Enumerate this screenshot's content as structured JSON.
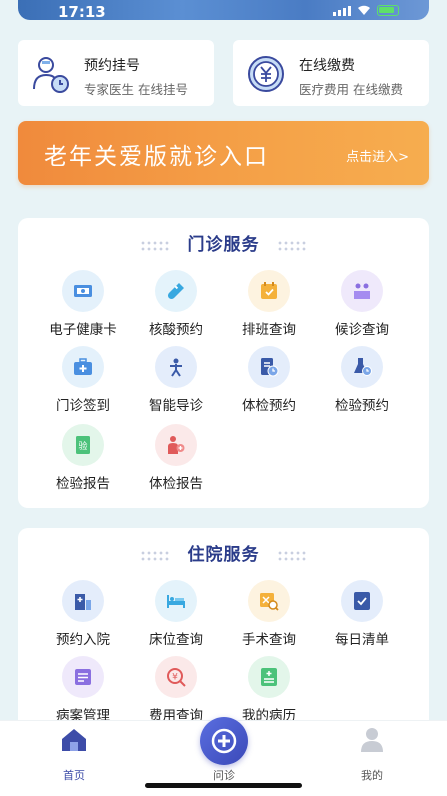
{
  "status": {
    "time": "17:13"
  },
  "quick": [
    {
      "title": "预约挂号",
      "sub": "专家医生 在线挂号",
      "icon": "doctor-appointment-icon"
    },
    {
      "title": "在线缴费",
      "sub": "医疗费用 在线缴费",
      "icon": "yuan-payment-icon"
    }
  ],
  "elder": {
    "title": "老年关爱版就诊入口",
    "link": "点击进入>"
  },
  "outpatient": {
    "title": "门诊服务",
    "items": [
      {
        "label": "电子健康卡",
        "icon": "health-card-icon"
      },
      {
        "label": "核酸预约",
        "icon": "test-tube-icon"
      },
      {
        "label": "排班查询",
        "icon": "calendar-icon"
      },
      {
        "label": "候诊查询",
        "icon": "waiting-room-icon"
      },
      {
        "label": "门诊签到",
        "icon": "medical-kit-icon"
      },
      {
        "label": "智能导诊",
        "icon": "guide-person-icon"
      },
      {
        "label": "体检预约",
        "icon": "checkup-clock-icon"
      },
      {
        "label": "检验预约",
        "icon": "flask-clock-icon"
      },
      {
        "label": "检验报告",
        "icon": "lab-report-icon"
      },
      {
        "label": "体检报告",
        "icon": "person-report-icon"
      }
    ]
  },
  "inpatient": {
    "title": "住院服务",
    "items": [
      {
        "label": "预约入院",
        "icon": "hospital-building-icon"
      },
      {
        "label": "床位查询",
        "icon": "bed-icon"
      },
      {
        "label": "手术查询",
        "icon": "surgery-search-icon"
      },
      {
        "label": "每日清单",
        "icon": "checklist-icon"
      },
      {
        "label": "病案管理",
        "icon": "case-file-icon"
      },
      {
        "label": "费用查询",
        "icon": "fee-search-icon"
      },
      {
        "label": "我的病历",
        "icon": "medical-record-icon"
      }
    ]
  },
  "tabs": [
    {
      "label": "首页",
      "icon": "home-icon"
    },
    {
      "label": "问诊",
      "icon": "plus-icon"
    },
    {
      "label": "我的",
      "icon": "user-icon"
    }
  ],
  "colors": {
    "accent": "#3d4ca8",
    "elder_orange": "#f39a44",
    "background": "#e8f3f6"
  }
}
